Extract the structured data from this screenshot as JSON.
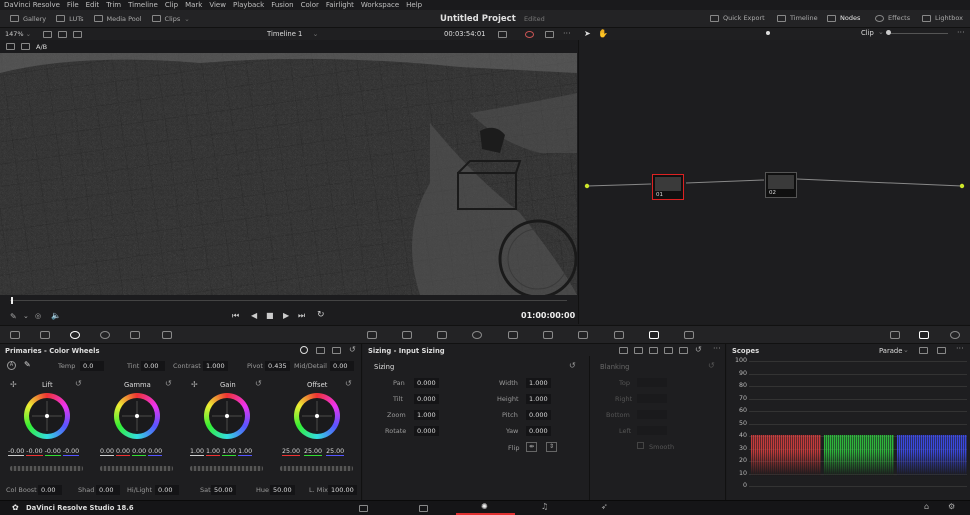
{
  "menu": [
    "DaVinci Resolve",
    "File",
    "Edit",
    "Trim",
    "Timeline",
    "Clip",
    "Mark",
    "View",
    "Playback",
    "Fusion",
    "Color",
    "Fairlight",
    "Workspace",
    "Help"
  ],
  "toolbar": {
    "gallery": "Gallery",
    "luts": "LUTs",
    "media_pool": "Media Pool",
    "clips": "Clips",
    "project_title": "Untitled Project",
    "project_status": "Edited",
    "quick_export": "Quick Export",
    "timeline": "Timeline",
    "nodes": "Nodes",
    "effects": "Effects",
    "lightbox": "Lightbox"
  },
  "viewer": {
    "zoom": "147%",
    "timeline_name": "Timeline 1",
    "timecode_top": "00:03:54:01",
    "ab_label": "A/B",
    "timecode": "01:00:00:00"
  },
  "nodes": {
    "mode": "Clip",
    "node1_label": "01",
    "node2_label": "02"
  },
  "primaries": {
    "title": "Primaries - Color Wheels",
    "temp_label": "Temp",
    "temp": "0.0",
    "tint_label": "Tint",
    "tint": "0.00",
    "contrast_label": "Contrast",
    "contrast": "1.000",
    "pivot_label": "Pivot",
    "pivot": "0.435",
    "middetail_label": "Mid/Detail",
    "middetail": "0.00",
    "wheels": [
      {
        "name": "Lift",
        "values": [
          "-0.00",
          "-0.00",
          "-0.00",
          "-0.00"
        ]
      },
      {
        "name": "Gamma",
        "values": [
          "0.00",
          "0.00",
          "0.00",
          "0.00"
        ]
      },
      {
        "name": "Gain",
        "values": [
          "1.00",
          "1.00",
          "1.00",
          "1.00"
        ]
      },
      {
        "name": "Offset",
        "values": [
          "25.00",
          "25.00",
          "25.00"
        ]
      }
    ],
    "colboost_label": "Col Boost",
    "colboost": "0.00",
    "shad_label": "Shad",
    "shad": "0.00",
    "hilight_label": "Hi/Light",
    "hilight": "0.00",
    "sat_label": "Sat",
    "sat": "50.00",
    "hue_label": "Hue",
    "hue": "50.00",
    "lmix_label": "L. Mix",
    "lmix": "100.00"
  },
  "sizing": {
    "panel_title": "Sizing - Input Sizing",
    "section": "Sizing",
    "pan_label": "Pan",
    "pan": "0.000",
    "tilt_label": "Tilt",
    "tilt": "0.000",
    "zoom_label": "Zoom",
    "zoom": "1.000",
    "rotate_label": "Rotate",
    "rotate": "0.000",
    "width_label": "Width",
    "width": "1.000",
    "height_label": "Height",
    "height": "1.000",
    "pitch_label": "Pitch",
    "pitch": "0.000",
    "yaw_label": "Yaw",
    "yaw": "0.000",
    "flip_label": "Flip",
    "blanking": "Blanking",
    "top_label": "Top",
    "right_label": "Right",
    "bottom_label": "Bottom",
    "left_label": "Left",
    "smooth_label": "Smooth"
  },
  "scopes": {
    "title": "Scopes",
    "mode": "Parade",
    "ticks": [
      "100",
      "90",
      "80",
      "70",
      "60",
      "50",
      "40",
      "30",
      "20",
      "10",
      "0"
    ]
  },
  "footer": {
    "app_name": "DaVinci Resolve Studio 18.6"
  },
  "colors": {
    "accent_red": "#e03030",
    "parade_red": "#e04040",
    "parade_green": "#30d040",
    "parade_blue": "#4050ff"
  }
}
